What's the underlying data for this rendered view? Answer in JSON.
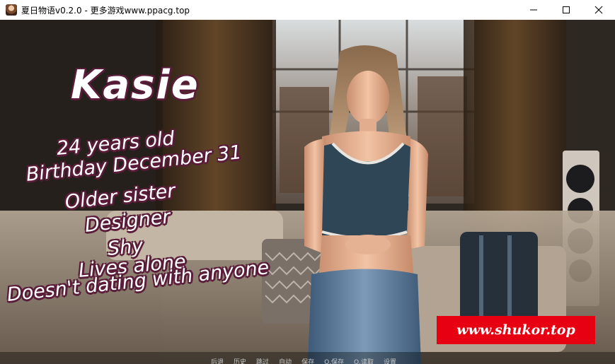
{
  "window": {
    "title": "夏日物语v0.2.0 - 更多游戏www.ppacg.top",
    "controls": [
      "minimize-icon",
      "maximize-icon",
      "close-icon"
    ]
  },
  "character": {
    "name": "Kasie",
    "traits": [
      "24 years old",
      "Birthday December 31",
      "Older sister",
      "Designer",
      "Shy",
      "Lives alone",
      "Doesn't dating with anyone"
    ]
  },
  "watermark": "www.shukor.top",
  "quick_menu": [
    "后退",
    "历史",
    "跳过",
    "自动",
    "保存",
    "Q.保存",
    "Q.读取",
    "设置"
  ],
  "colors": {
    "text_outline": "#5a1d3a",
    "watermark_bg": "#e60012"
  }
}
